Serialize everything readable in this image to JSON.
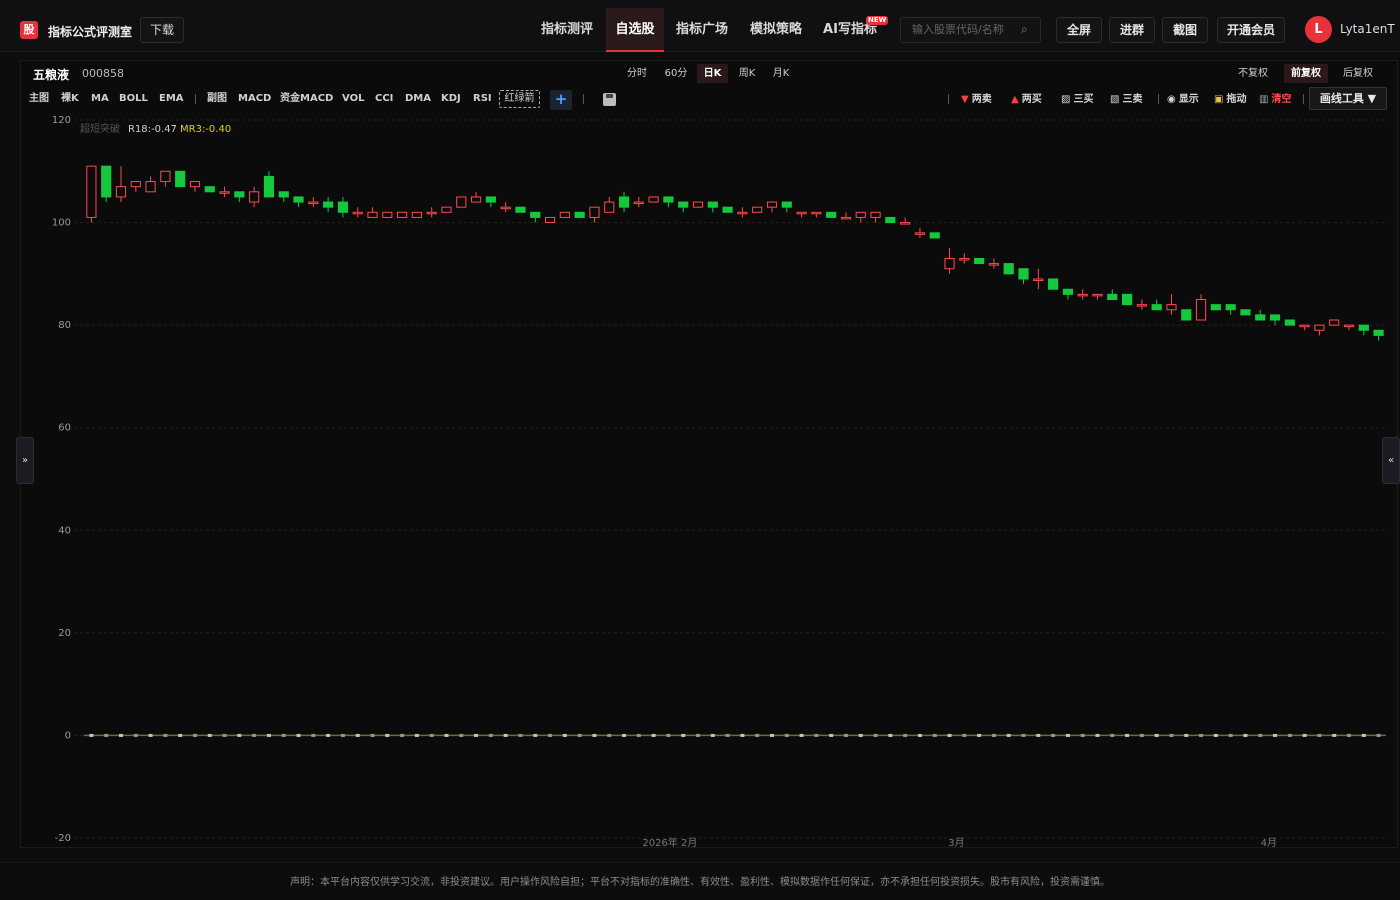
{
  "header": {
    "logo_char": "股",
    "brand": "指标公式评测室",
    "download_label": "下载",
    "nav": [
      {
        "label": "指标测评",
        "active": false
      },
      {
        "label": "自选股",
        "active": true
      },
      {
        "label": "指标广场",
        "active": false
      },
      {
        "label": "模拟策略",
        "active": false
      },
      {
        "label": "AI写指标",
        "active": false,
        "badge": "NEW"
      }
    ],
    "search_placeholder": "输入股票代码/名称",
    "buttons": [
      "全屏",
      "进群",
      "截图",
      "开通会员"
    ],
    "avatar_initial": "L",
    "username": "Lyta1enT"
  },
  "stock": {
    "name": "五粮液",
    "code": "000858"
  },
  "periods": [
    {
      "label": "分时",
      "active": false
    },
    {
      "label": "60分",
      "active": false
    },
    {
      "label": "日K",
      "active": true
    },
    {
      "label": "周K",
      "active": false
    },
    {
      "label": "月K",
      "active": false
    }
  ],
  "adjust": [
    {
      "label": "不复权",
      "active": false
    },
    {
      "label": "前复权",
      "active": true
    },
    {
      "label": "后复权",
      "active": false
    }
  ],
  "indicators_main": [
    "主图",
    "裸K",
    "MA",
    "BOLL",
    "EMA"
  ],
  "indicators_sub": [
    "副图",
    "MACD",
    "资金MACD",
    "VOL",
    "CCI",
    "DMA",
    "KDJ",
    "RSI"
  ],
  "highlight_indicator": "红绿箭",
  "add_label": "+",
  "draw_tools": [
    {
      "label": "两卖",
      "icon": "down-triangle",
      "color": "#ff4b4b"
    },
    {
      "label": "两买",
      "icon": "up-triangle",
      "color": "#ff4b4b"
    },
    {
      "label": "三买",
      "icon": "chart-up-icon",
      "color": "#ddd"
    },
    {
      "label": "三卖",
      "icon": "chart-down-icon",
      "color": "#ddd"
    },
    {
      "label": "显示",
      "icon": "eye-icon",
      "color": "#ddd"
    },
    {
      "label": "拖动",
      "icon": "lock-icon",
      "color": "#ddd"
    },
    {
      "label": "清空",
      "icon": "trash-icon",
      "color": "#ff4b4b"
    }
  ],
  "draw_tools_button": "画线工具 ▼",
  "side_left": "»",
  "side_right": "«",
  "chart_data": {
    "type": "candlestick",
    "ylim": [
      -20,
      120
    ],
    "yticks": [
      120,
      100,
      80,
      60,
      40,
      20,
      0,
      -20
    ],
    "legend": [
      {
        "text": "超短突破",
        "color": "#555"
      },
      {
        "text": "R18:-0.47",
        "color": "#d0d0d0"
      },
      {
        "text": "MR3:-0.40",
        "color": "#e0d500"
      }
    ],
    "x_month_labels": [
      "2026年 2月",
      "3月",
      "4月"
    ],
    "candles": [
      [
        101,
        111,
        100,
        111
      ],
      [
        111,
        105,
        104,
        111
      ],
      [
        105,
        107,
        104,
        111
      ],
      [
        107,
        108,
        106,
        108
      ],
      [
        106,
        108,
        106,
        109
      ],
      [
        108,
        110,
        107,
        110
      ],
      [
        110,
        107,
        107,
        110
      ],
      [
        107,
        108,
        106,
        108
      ],
      [
        107,
        106,
        106,
        107
      ],
      [
        106,
        106,
        105,
        107
      ],
      [
        106,
        105,
        104,
        106
      ],
      [
        104,
        106,
        103,
        107
      ],
      [
        109,
        105,
        105,
        110
      ],
      [
        106,
        105,
        104,
        106
      ],
      [
        105,
        104,
        103,
        105
      ],
      [
        104,
        104,
        103,
        105
      ],
      [
        104,
        103,
        102,
        105
      ],
      [
        104,
        102,
        101,
        105
      ],
      [
        102,
        102,
        101,
        103
      ],
      [
        101,
        102,
        101,
        103
      ],
      [
        101,
        102,
        101,
        102
      ],
      [
        101,
        102,
        101,
        102
      ],
      [
        101,
        102,
        101,
        102
      ],
      [
        102,
        102,
        101,
        103
      ],
      [
        102,
        103,
        102,
        103
      ],
      [
        103,
        105,
        103,
        105
      ],
      [
        104,
        105,
        104,
        106
      ],
      [
        105,
        104,
        103,
        105
      ],
      [
        103,
        103,
        102,
        104
      ],
      [
        103,
        102,
        102,
        103
      ],
      [
        102,
        101,
        100,
        102
      ],
      [
        100,
        101,
        100,
        101
      ],
      [
        101,
        102,
        101,
        102
      ],
      [
        102,
        101,
        101,
        102
      ],
      [
        101,
        103,
        100,
        103
      ],
      [
        102,
        104,
        102,
        105
      ],
      [
        105,
        103,
        102,
        106
      ],
      [
        104,
        104,
        103,
        105
      ],
      [
        104,
        105,
        104,
        105
      ],
      [
        105,
        104,
        103,
        105
      ],
      [
        104,
        103,
        102,
        104
      ],
      [
        103,
        104,
        103,
        104
      ],
      [
        104,
        103,
        102,
        104
      ],
      [
        103,
        102,
        102,
        103
      ],
      [
        102,
        102,
        101,
        103
      ],
      [
        102,
        103,
        102,
        103
      ],
      [
        103,
        104,
        102,
        104
      ],
      [
        104,
        103,
        102,
        104
      ],
      [
        102,
        102,
        101,
        102
      ],
      [
        102,
        102,
        101,
        102
      ],
      [
        102,
        101,
        101,
        102
      ],
      [
        101,
        101,
        101,
        102
      ],
      [
        101,
        102,
        100,
        102
      ],
      [
        101,
        102,
        100,
        102
      ],
      [
        101,
        100,
        100,
        101
      ],
      [
        100,
        100,
        100,
        101
      ],
      [
        98,
        98,
        97,
        99
      ],
      [
        98,
        97,
        97,
        98
      ],
      [
        91,
        93,
        90,
        95
      ],
      [
        93,
        93,
        92,
        94
      ],
      [
        93,
        92,
        92,
        93
      ],
      [
        92,
        92,
        91,
        93
      ],
      [
        92,
        90,
        90,
        92
      ],
      [
        91,
        89,
        88,
        91
      ],
      [
        89,
        89,
        87,
        91
      ],
      [
        89,
        87,
        87,
        89
      ],
      [
        87,
        86,
        85,
        87
      ],
      [
        86,
        86,
        85,
        87
      ],
      [
        86,
        86,
        85,
        86
      ],
      [
        86,
        85,
        85,
        87
      ],
      [
        86,
        84,
        84,
        86
      ],
      [
        84,
        84,
        83,
        85
      ],
      [
        84,
        83,
        83,
        85
      ],
      [
        83,
        84,
        82,
        86
      ],
      [
        83,
        81,
        81,
        83
      ],
      [
        81,
        85,
        81,
        86
      ],
      [
        84,
        83,
        83,
        84
      ],
      [
        84,
        83,
        82,
        84
      ],
      [
        83,
        82,
        82,
        83
      ],
      [
        82,
        81,
        81,
        83
      ],
      [
        82,
        81,
        80,
        82
      ],
      [
        81,
        80,
        80,
        81
      ],
      [
        80,
        80,
        79,
        80
      ],
      [
        79,
        80,
        78,
        80
      ],
      [
        80,
        81,
        80,
        81
      ],
      [
        80,
        80,
        79,
        80
      ],
      [
        80,
        79,
        78,
        80
      ],
      [
        79,
        78,
        77,
        79
      ]
    ]
  },
  "disclaimer": "声明：本平台内容仅供学习交流，非投资建议。用户操作风险自担；平台不对指标的准确性、有效性、盈利性、模拟数据作任何保证，亦不承担任何投资损失。股市有风险，投资需谨慎。"
}
